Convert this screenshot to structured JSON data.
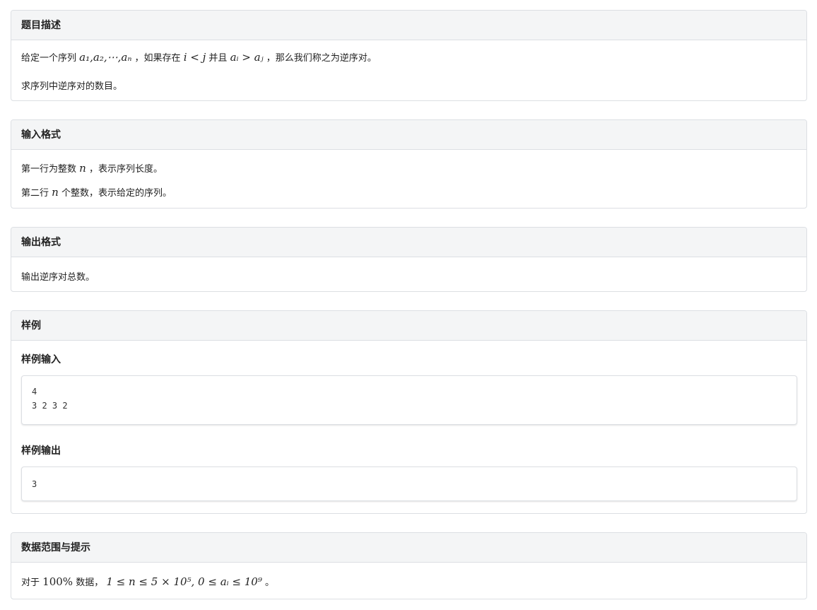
{
  "description": {
    "title": "题目描述",
    "l1_a": "给定一个序列",
    "l1_seq": "a₁,a₂,⋯,aₙ",
    "l1_b": "，如果存在",
    "l1_cond1": "i < j",
    "l1_c": "并且",
    "l1_cond2": "aᵢ > aⱼ",
    "l1_d": "，那么我们称之为逆序对。",
    "l2": "求序列中逆序对的数目。"
  },
  "input": {
    "title": "输入格式",
    "l1_a": "第一行为整数",
    "l1_var": "n",
    "l1_b": "，表示序列长度。",
    "l2_a": "第二行",
    "l2_var": "n",
    "l2_b": "个整数，表示给定的序列。"
  },
  "output": {
    "title": "输出格式",
    "l1": "输出逆序对总数。"
  },
  "sample": {
    "title": "样例",
    "input_label": "样例输入",
    "input_code": "4\n3 2 3 2",
    "output_label": "样例输出",
    "output_code": "3"
  },
  "hint": {
    "title": "数据范围与提示",
    "a": "对于",
    "pct": "100%",
    "b": "数据，",
    "formula": "1 ≤ n ≤ 5 × 10⁵, 0 ≤ aᵢ ≤ 10⁹",
    "c": "。"
  }
}
